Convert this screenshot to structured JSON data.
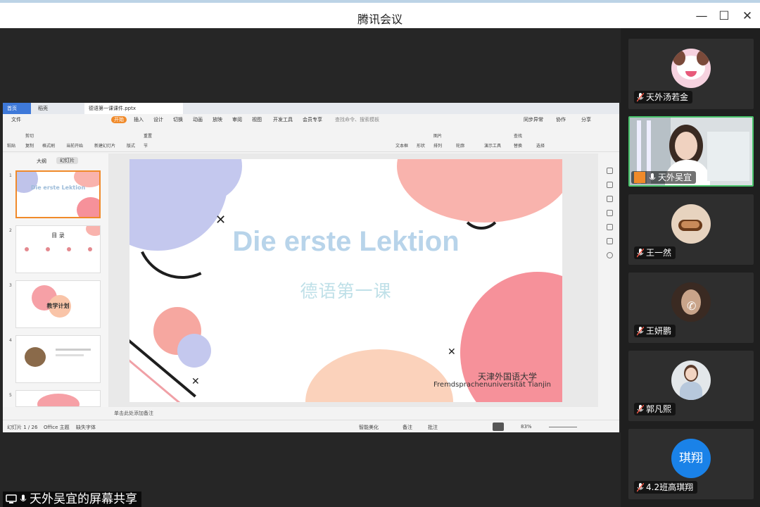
{
  "window": {
    "title": "腾讯会议",
    "minimize": "—",
    "maximize": "☐",
    "close": "✕"
  },
  "participants": [
    {
      "name": "天外汤若金",
      "avatar": "cartoon-avatar",
      "active": false
    },
    {
      "name": "天外吴宜",
      "avatar": "video-feed",
      "active": true
    },
    {
      "name": "王一然",
      "avatar": "photo-avatar",
      "active": false
    },
    {
      "name": "王妍鹏",
      "avatar": "photo-avatar",
      "active": false
    },
    {
      "name": "郭凡熙",
      "avatar": "photo-avatar",
      "active": false
    },
    {
      "name": "4.2班高琪翔",
      "avatar": "text-avatar",
      "initials": "琪翔",
      "avatar_color": "#1a82e8",
      "active": false
    }
  ],
  "share": {
    "label": "天外吴宜的屏幕共享"
  },
  "wps": {
    "tabs": [
      "首页",
      "稻壳",
      "德语第一课课件.pptx"
    ],
    "menus": [
      "文件",
      "开始",
      "插入",
      "设计",
      "切换",
      "动画",
      "放映",
      "审阅",
      "视图",
      "开发工具",
      "会员专享",
      "查找命令、搜索模板"
    ],
    "menu_right": [
      "同步异常",
      "协作",
      "分享"
    ],
    "toolbar": [
      "粘贴",
      "剪切",
      "复制",
      "格式刷",
      "当前开始",
      "新建幻灯片",
      "版式",
      "节",
      "重置",
      "文本框",
      "形状",
      "排列",
      "图片",
      "轮廓",
      "演示工具",
      "查找",
      "替换",
      "选择"
    ],
    "pane_tabs": [
      "大纲",
      "幻灯片"
    ],
    "slide_thumbs": [
      {
        "num": "1",
        "title": "Die erste Lektion"
      },
      {
        "num": "2",
        "title": "目 录"
      },
      {
        "num": "3",
        "title": "教学计划"
      },
      {
        "num": "4",
        "title": ""
      },
      {
        "num": "5",
        "title": ""
      }
    ],
    "slide": {
      "title": "Die erste Lektion",
      "subtitle": "德语第一课",
      "university_cn": "天津外国语大学",
      "university_de": "Fremdsprachenuniversität Tianjin"
    },
    "notes_placeholder": "单击此处添加备注",
    "status": {
      "slide_count": "幻灯片 1 / 26",
      "theme": "Office 主题",
      "font_missing": "缺失字体",
      "smart_beautify": "智能美化",
      "notes": "备注",
      "comments": "批注",
      "zoom": "83%"
    }
  },
  "colors": {
    "active_border": "#49c36b",
    "accent_orange": "#f08a2a",
    "slide_title": "#b8d4ea",
    "slide_subtitle": "#bfe0e8"
  }
}
